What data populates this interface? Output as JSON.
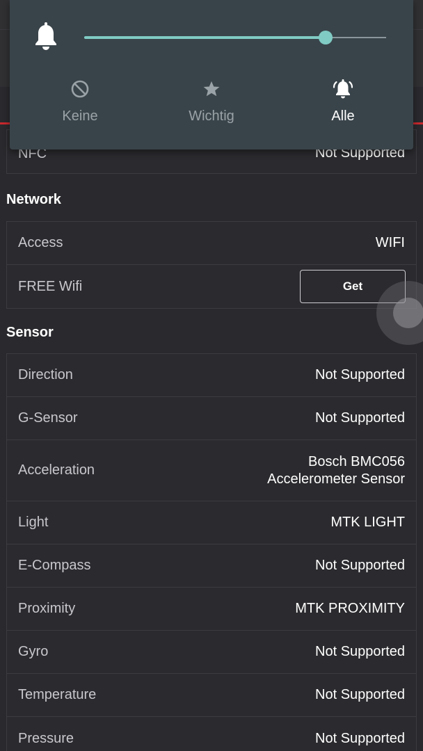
{
  "notification_panel": {
    "volume_level_percent": 80,
    "modes": [
      {
        "label": "Keine",
        "icon": "none-block-icon",
        "active": false
      },
      {
        "label": "Wichtig",
        "icon": "star-icon",
        "active": false
      },
      {
        "label": "Alle",
        "icon": "bell-ringing-icon",
        "active": true
      }
    ]
  },
  "partial_row": {
    "label": "NFC",
    "value": "Not Supported"
  },
  "network": {
    "title": "Network",
    "rows": [
      {
        "label": "Access",
        "value": "WIFI"
      },
      {
        "label": "FREE Wifi",
        "button": "Get"
      }
    ]
  },
  "sensor": {
    "title": "Sensor",
    "rows": [
      {
        "label": "Direction",
        "value": "Not Supported"
      },
      {
        "label": "G-Sensor",
        "value": "Not Supported"
      },
      {
        "label": "Acceleration",
        "value_line1": "Bosch BMC056",
        "value_line2": "Accelerometer Sensor"
      },
      {
        "label": "Light",
        "value": "MTK LIGHT"
      },
      {
        "label": "E-Compass",
        "value": "Not Supported"
      },
      {
        "label": "Proximity",
        "value": "MTK PROXIMITY"
      },
      {
        "label": "Gyro",
        "value": "Not Supported"
      },
      {
        "label": "Temperature",
        "value": "Not Supported"
      },
      {
        "label": "Pressure",
        "value": "Not Supported"
      }
    ]
  },
  "colors": {
    "accent": "#80cbc4",
    "brand_red": "#c8282e",
    "panel_bg": "#39444a",
    "page_bg": "#2a2a2e"
  }
}
